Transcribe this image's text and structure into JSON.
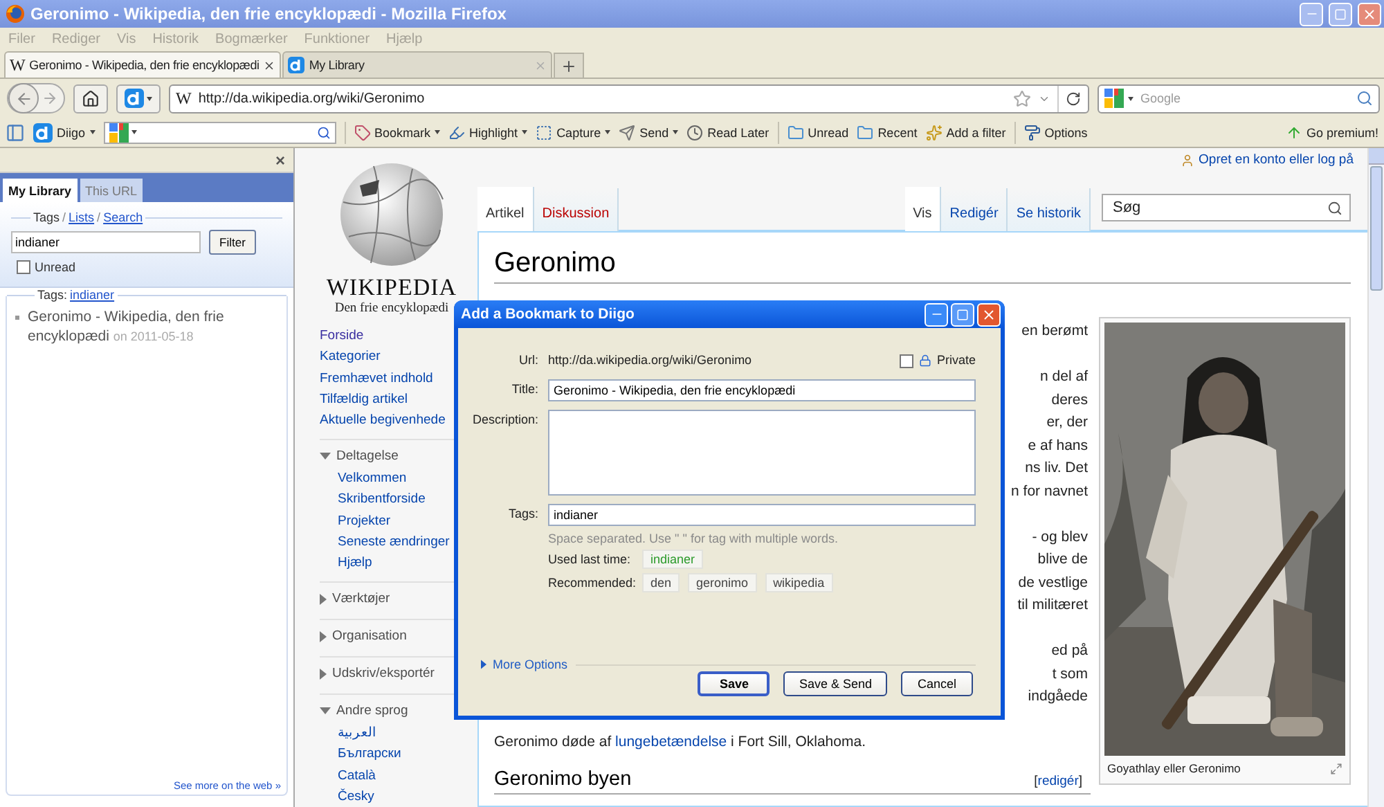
{
  "window": {
    "title": "Geronimo - Wikipedia, den frie encyklopædi - Mozilla Firefox"
  },
  "menu": [
    "Filer",
    "Rediger",
    "Vis",
    "Historik",
    "Bogmærker",
    "Funktioner",
    "Hjælp"
  ],
  "tabs": [
    {
      "favicon": "W",
      "label": "Geronimo - Wikipedia, den frie encyklopædi",
      "selected": true
    },
    {
      "label": "My Library",
      "selected": false
    }
  ],
  "nav": {
    "url_favicon": "W",
    "url": "http://da.wikipedia.org/wiki/Geronimo",
    "search": {
      "placeholder": "Google"
    }
  },
  "diigo_toolbar": {
    "brand": "Diigo",
    "items": [
      {
        "label": "Bookmark",
        "dropdown": true
      },
      {
        "label": "Highlight",
        "dropdown": true
      },
      {
        "label": "Capture",
        "dropdown": true
      },
      {
        "label": "Send",
        "dropdown": true
      },
      {
        "label": "Read Later",
        "dropdown": false
      },
      {
        "label": "Unread",
        "dropdown": false
      },
      {
        "label": "Recent",
        "dropdown": false
      },
      {
        "label": "Add a filter",
        "dropdown": false
      },
      {
        "label": "Options",
        "dropdown": false
      }
    ],
    "premium": "Go premium!"
  },
  "sidebar": {
    "close": "×",
    "tabs": [
      {
        "label": "My Library",
        "selected": true
      },
      {
        "label": "This URL",
        "selected": false
      }
    ],
    "separator": "/",
    "modes": [
      {
        "label": "Tags",
        "selected": true
      },
      {
        "label": "Lists",
        "selected": false
      },
      {
        "label": "Search",
        "selected": false
      }
    ],
    "filter": {
      "value": "indianer",
      "button": "Filter"
    },
    "unread": {
      "label": "Unread",
      "checked": false
    },
    "results_legend": {
      "label": "Tags:",
      "tag": "indianer"
    },
    "items": [
      {
        "title": "Geronimo - Wikipedia, den frie encyklopædi",
        "date": "on 2011-05-18"
      }
    ],
    "see_more": "See more on the web »"
  },
  "wiki": {
    "logo": {
      "wordmark": "WIKIPEDIA",
      "tagline": "Den frie encyklopædi"
    },
    "personal": "Opret en konto eller log på",
    "nav_main": [
      {
        "label": "Forside",
        "visited": true
      },
      {
        "label": "Kategorier",
        "visited": false
      },
      {
        "label": "Fremhævet indhold",
        "visited": false
      },
      {
        "label": "Tilfældig artikel",
        "visited": false
      },
      {
        "label": "Aktuelle begivenhede",
        "visited": false
      }
    ],
    "portals": [
      {
        "title": "Deltagelse",
        "expanded": true,
        "links": [
          "Velkommen",
          "Skribentforside",
          "Projekter",
          "Seneste ændringer",
          "Hjælp"
        ]
      },
      {
        "title": "Værktøjer",
        "expanded": false
      },
      {
        "title": "Organisation",
        "expanded": false
      },
      {
        "title": "Udskriv/eksportér",
        "expanded": false
      },
      {
        "title": "Andre sprog",
        "expanded": true,
        "links": [
          "العربية",
          "Български",
          "Català",
          "Česky"
        ]
      }
    ],
    "namespace_tabs": [
      {
        "label": "Artikel",
        "selected": true,
        "new": false
      },
      {
        "label": "Diskussion",
        "selected": false,
        "new": true
      }
    ],
    "view_tabs": [
      {
        "label": "Vis",
        "selected": true
      },
      {
        "label": "Redigér",
        "selected": false
      },
      {
        "label": "Se historik",
        "selected": false
      }
    ],
    "search": {
      "placeholder": "Søg"
    },
    "heading": "Geronimo",
    "fragments": [
      [
        "en berømt"
      ],
      [
        "n del af",
        "deres",
        "er, der",
        "e af hans",
        "ns liv. Det",
        "n for navnet"
      ],
      [
        "- og blev",
        "blive de",
        "de vestlige",
        "til militæret"
      ],
      [
        "ed på",
        "t som",
        "indgåede"
      ]
    ],
    "closing": {
      "before": "Geronimo døde af ",
      "link": "lungebetændelse",
      "after": " i Fort Sill, Oklahoma."
    },
    "section": {
      "heading": "Geronimo byen",
      "edit_open": "[",
      "edit": "redigér",
      "edit_close": "]"
    },
    "figure": {
      "kind": "picture",
      "caption": "Goyathlay eller Geronimo"
    }
  },
  "dialog": {
    "title": "Add a Bookmark to Diigo",
    "url_label": "Url:",
    "url": "http://da.wikipedia.org/wiki/Geronimo",
    "private": {
      "label": "Private",
      "checked": false
    },
    "title_label": "Title:",
    "title_value": "Geronimo - Wikipedia, den frie encyklopædi",
    "description_label": "Description:",
    "tags_label": "Tags:",
    "tags_value": "indianer",
    "tags_hint": "Space separated. Use \" \" for tag with multiple words.",
    "used_label": "Used last time:",
    "used_tags": [
      "indianer"
    ],
    "recommended_label": "Recommended:",
    "recommended_tags": [
      "den",
      "geronimo",
      "wikipedia"
    ],
    "more_options": {
      "label": "More Options",
      "expanded": false
    },
    "buttons": [
      {
        "label": "Save",
        "default": true
      },
      {
        "label": "Save & Send",
        "default": false
      },
      {
        "label": "Cancel",
        "default": false
      }
    ]
  }
}
